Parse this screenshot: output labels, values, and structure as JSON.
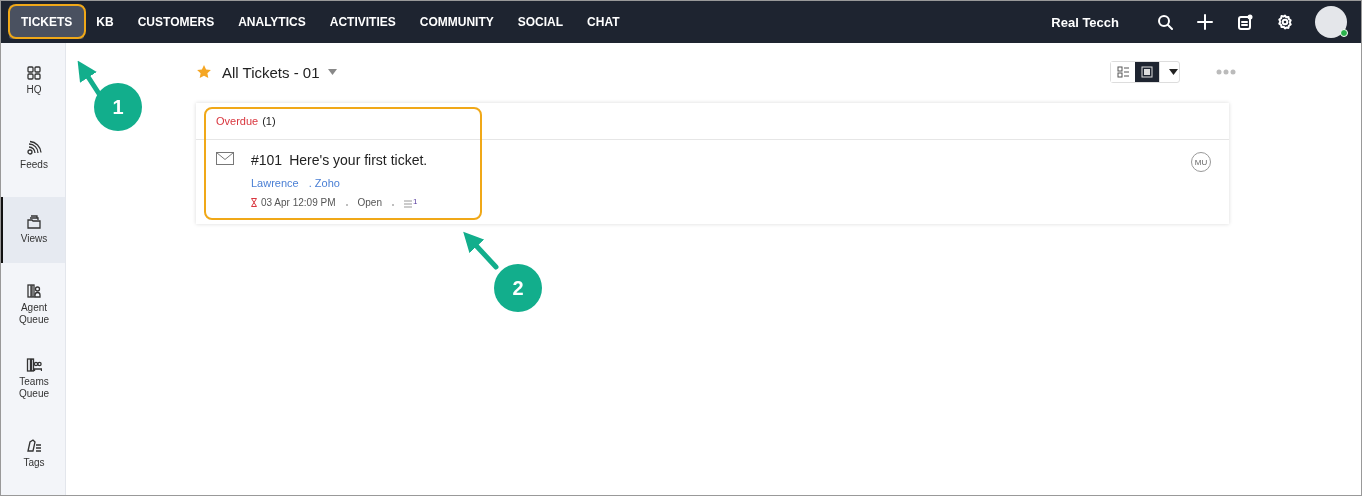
{
  "top_nav": {
    "tabs": [
      {
        "label": "TICKETS",
        "selected": true
      },
      {
        "label": "KB",
        "selected": false
      },
      {
        "label": "CUSTOMERS",
        "selected": false
      },
      {
        "label": "ANALYTICS",
        "selected": false
      },
      {
        "label": "ACTIVITIES",
        "selected": false
      },
      {
        "label": "COMMUNITY",
        "selected": false
      },
      {
        "label": "SOCIAL",
        "selected": false
      },
      {
        "label": "CHAT",
        "selected": false
      }
    ],
    "portal": "Real Tecch",
    "user_online": true
  },
  "sidebar": {
    "items": [
      {
        "kind": "hq",
        "label": "HQ",
        "selected": false
      },
      {
        "kind": "feeds",
        "label": "Feeds",
        "selected": false
      },
      {
        "kind": "views",
        "label": "Views",
        "selected": true
      },
      {
        "kind": "agent",
        "label": "Agent Queue",
        "selected": false
      },
      {
        "kind": "teams",
        "label": "Teams Queue",
        "selected": false
      },
      {
        "kind": "tags",
        "label": "Tags",
        "selected": false
      }
    ]
  },
  "view": {
    "title": "All Tickets - 01",
    "starred": true,
    "layouts": [
      {
        "kind": "list",
        "selected": false
      },
      {
        "kind": "card",
        "selected": true
      }
    ]
  },
  "groups": [
    {
      "label": "Overdue",
      "count": "(1)",
      "tickets": [
        {
          "number": "#101",
          "subject": "Here's your first ticket.",
          "contact": "Lawrence",
          "account": ". Zoho",
          "due": "03 Apr 12:09 PM",
          "status": "Open",
          "threads": "1",
          "assignee": "MU"
        }
      ]
    }
  ],
  "annotations": [
    {
      "label": "1"
    },
    {
      "label": "2"
    }
  ]
}
